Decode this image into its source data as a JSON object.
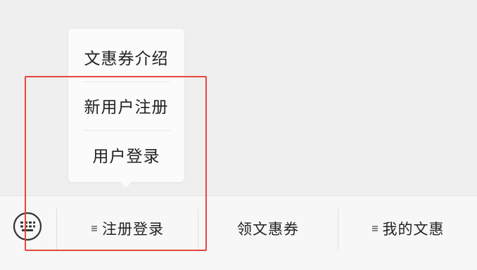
{
  "popup_menu": {
    "items": [
      {
        "label": "文惠券介绍"
      },
      {
        "label": "新用户注册"
      },
      {
        "label": "用户登录"
      }
    ]
  },
  "bottom_bar": {
    "keyboard_icon": "keyboard-icon",
    "tabs": [
      {
        "label": "注册登录",
        "has_submenu": true,
        "icon": "list-icon"
      },
      {
        "label": "领文惠券",
        "has_submenu": false
      },
      {
        "label": "我的文惠",
        "has_submenu": true,
        "icon": "list-icon"
      }
    ]
  },
  "colors": {
    "highlight": "#e6463f",
    "background": "#efefef",
    "bar_background": "#f7f7f7",
    "popup_background": "#fbfbfb"
  }
}
